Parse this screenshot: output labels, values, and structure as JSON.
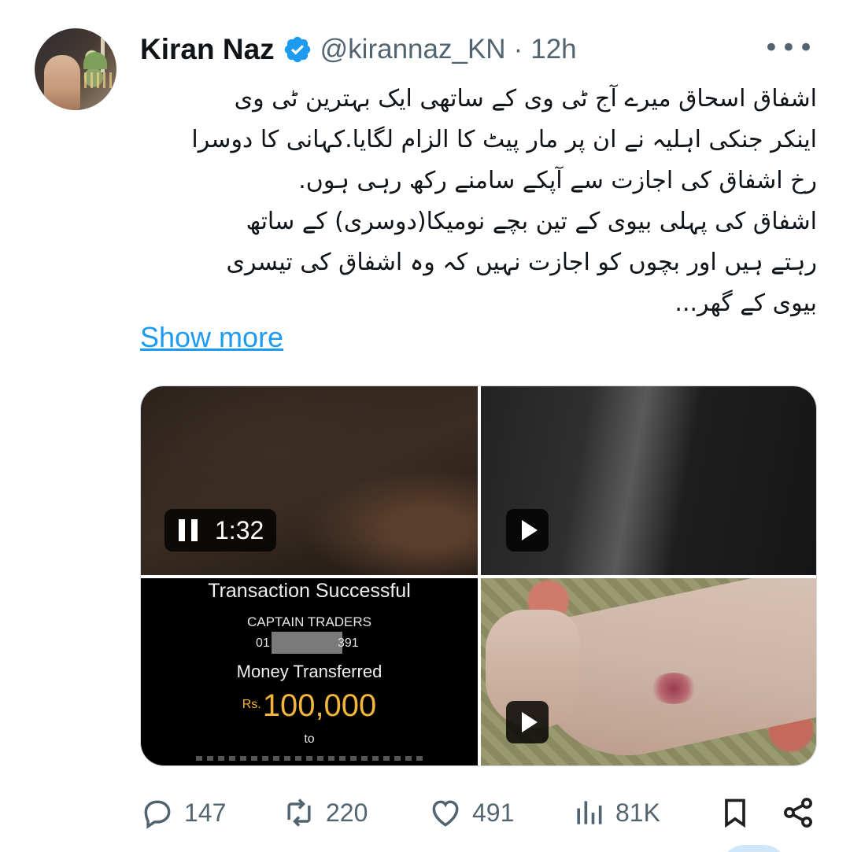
{
  "author": {
    "name": "Kiran Naz",
    "handle": "@kirannaz_KN",
    "separator": "·",
    "time": "12h",
    "verified": true
  },
  "menu": {
    "more_label": "•••"
  },
  "tweet": {
    "lines": [
      "اشفاق اسحاق میرے آج ٹی وی کے ساتھی ایک بہترین ٹی وی",
      "اینکر جنکی اہلیہ نے ان پر مار پیٹ کا الزام لگایا.کہانی کا دوسرا",
      "رخ اشفاق کی اجازت سے آپکے سامنے رکھ رہی ہوں.",
      "اشفاق کی پہلی بیوی کے تین بچے نومیکا(دوسری) کے ساتھ",
      "رہتے ہیں اور بچوں کو اجازت نہیں کہ وہ اشفاق کی تیسری",
      "بیوی کے گھر..."
    ],
    "show_more": "Show more"
  },
  "media": {
    "video1": {
      "duration": "1:32",
      "state": "playing"
    },
    "transaction": {
      "title": "Transaction Successful",
      "payee": "CAPTAIN TRADERS",
      "account_start": "01",
      "account_end": "391",
      "money_label": "Money Transferred",
      "currency": "Rs.",
      "amount": "100,000",
      "to": "to"
    }
  },
  "stats": {
    "replies": "147",
    "reposts": "220",
    "likes": "491",
    "views": "81K"
  },
  "colors": {
    "text": "#0f1419",
    "secondary": "#536471",
    "link": "#1d9bf0",
    "verified": "#1d9bf0",
    "amount": "#f4b63a"
  },
  "icons": [
    "reply-icon",
    "repost-icon",
    "like-icon",
    "views-icon",
    "bookmark-icon",
    "share-icon",
    "verified-badge-icon",
    "pause-icon",
    "play-icon"
  ]
}
